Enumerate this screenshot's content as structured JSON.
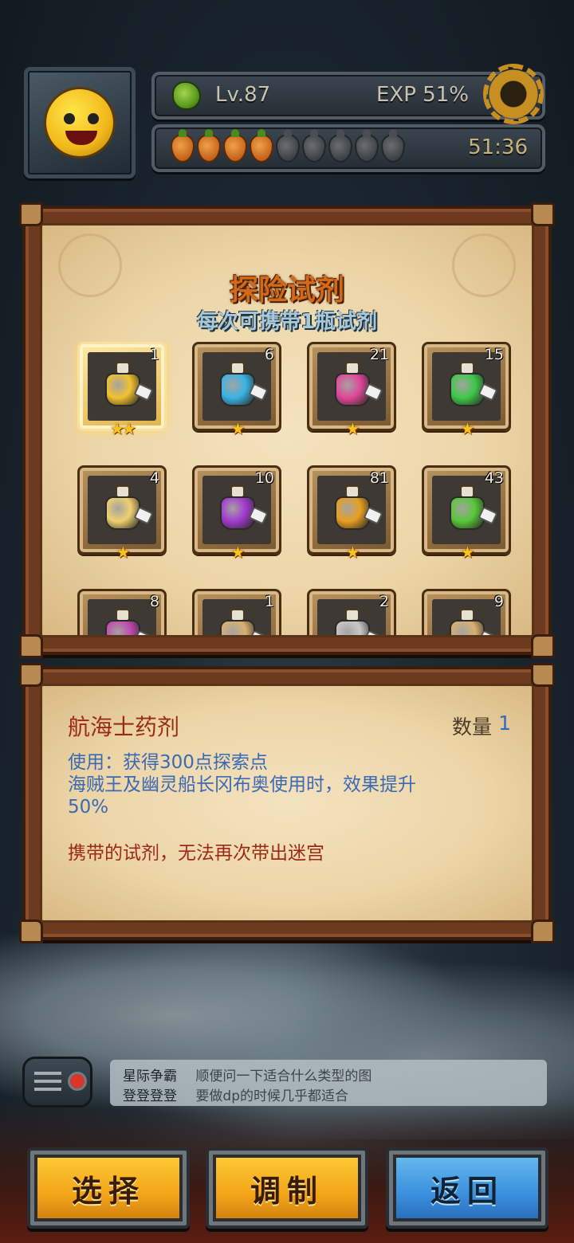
{
  "hud": {
    "level": "Lv.87",
    "exp": "EXP 51%",
    "timer": "51:36",
    "carrots_filled": 4,
    "carrots_total": 9,
    "icons": [
      "avatar-miner",
      "leaf-icon",
      "gear-icon",
      "carrot-icon"
    ]
  },
  "potion_panel": {
    "title": "探险试剂",
    "subtitle": "每次可携带1瓶试剂",
    "slots": [
      {
        "count": "1",
        "stars": "★★",
        "color": "#f2c230",
        "selected": true
      },
      {
        "count": "6",
        "stars": "★",
        "color": "#39b4e6",
        "selected": false
      },
      {
        "count": "21",
        "stars": "★",
        "color": "#e0479a",
        "selected": false
      },
      {
        "count": "15",
        "stars": "★",
        "color": "#3fc84a",
        "selected": false
      },
      {
        "count": "4",
        "stars": "★",
        "color": "#f0d070",
        "selected": false
      },
      {
        "count": "10",
        "stars": "★",
        "color": "#a23ad0",
        "selected": false
      },
      {
        "count": "81",
        "stars": "★",
        "color": "#e8a020",
        "selected": false
      },
      {
        "count": "43",
        "stars": "★",
        "color": "#58c83a",
        "selected": false
      },
      {
        "count": "8",
        "stars": "",
        "color": "#c04ab0",
        "selected": false
      },
      {
        "count": "1",
        "stars": "",
        "color": "#d8b070",
        "selected": false
      },
      {
        "count": "2",
        "stars": "",
        "color": "#c8c8c8",
        "selected": false
      },
      {
        "count": "9",
        "stars": "",
        "color": "#d8b070",
        "selected": false
      }
    ]
  },
  "info_panel": {
    "name": "航海士药剂",
    "quantity_label": "数量",
    "quantity_value": "1",
    "description": "使用：获得300点探索点\n海贼王及幽灵船长冈布奥使用时，效果提升\n50%",
    "warning": "携带的试剂，无法再次带出迷宫"
  },
  "chat": {
    "messages": [
      {
        "user": "星际争霸",
        "text": "顺便问一下适合什么类型的图"
      },
      {
        "user": "登登登登",
        "text": "要做dp的时候几乎都适合"
      }
    ]
  },
  "buttons": {
    "select": "选择",
    "brew": "调制",
    "back": "返回"
  }
}
